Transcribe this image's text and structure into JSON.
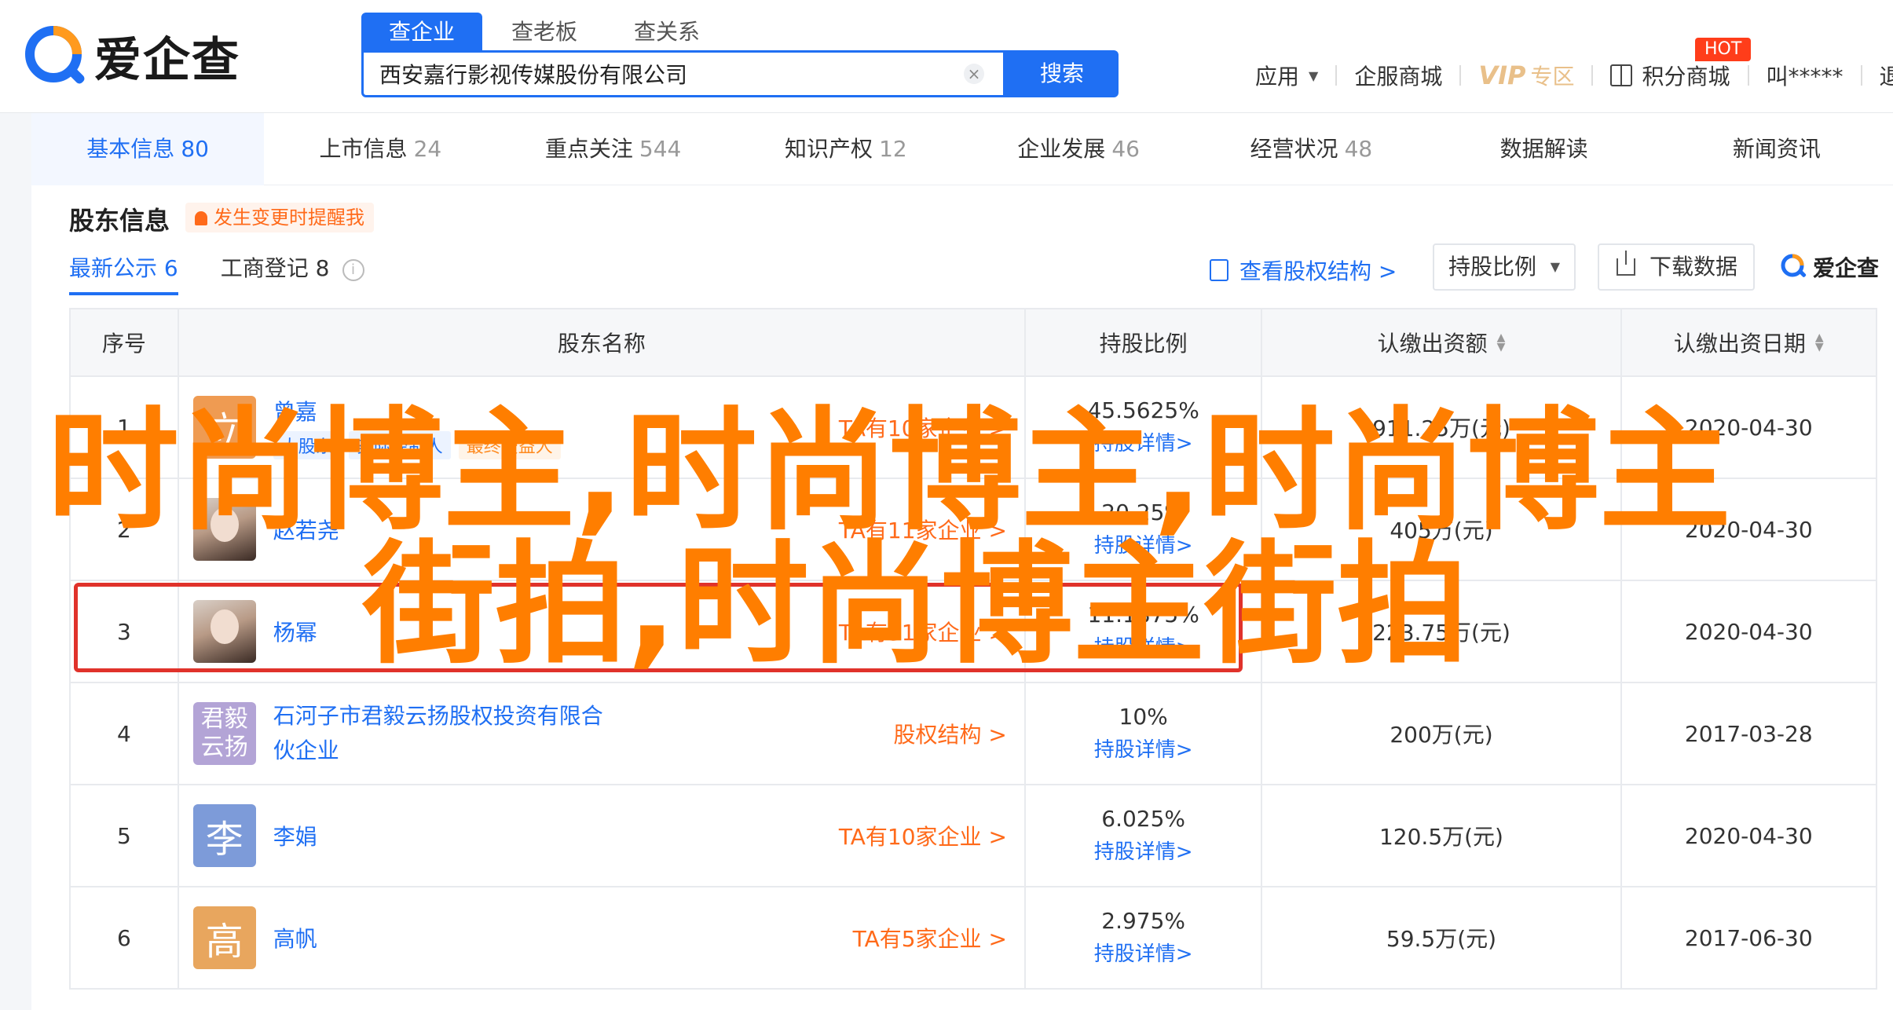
{
  "header": {
    "logo_text": "爱企查",
    "search_tabs": [
      "查企业",
      "查老板",
      "查关系"
    ],
    "search_value": "西安嘉行影视传媒股份有限公司",
    "search_button": "搜索",
    "nav": {
      "apps": "应用",
      "enterprise_mall": "企服商城",
      "vip": "VIP",
      "vip_zone": "专区",
      "points_mall": "积分商城",
      "hot_badge": "HOT",
      "user": "叫*****",
      "logout": "退出"
    }
  },
  "tabs": [
    {
      "label": "基本信息",
      "count": "80"
    },
    {
      "label": "上市信息",
      "count": "24"
    },
    {
      "label": "重点关注",
      "count": "544"
    },
    {
      "label": "知识产权",
      "count": "12"
    },
    {
      "label": "企业发展",
      "count": "46"
    },
    {
      "label": "经营状况",
      "count": "48"
    },
    {
      "label": "数据解读",
      "count": ""
    },
    {
      "label": "新闻资讯",
      "count": ""
    }
  ],
  "section": {
    "title": "股东信息",
    "alert": "发生变更时提醒我",
    "subtabs": [
      {
        "label": "最新公示",
        "count": "6"
      },
      {
        "label": "工商登记",
        "count": "8"
      }
    ],
    "equity_link": "查看股权结构 >",
    "dropdown": "持股比例",
    "download": "下载数据",
    "watermark_logo": "爱企查"
  },
  "table": {
    "headers": [
      "序号",
      "股东名称",
      "持股比例",
      "认缴出资额",
      "认缴出资日期"
    ],
    "rows": [
      {
        "idx": "1",
        "avatar": "立",
        "name": "曾嘉",
        "tags": [
          "大股东",
          "实际控制人",
          "最终受益人"
        ],
        "assoc": "TA有10家企业 >",
        "ratio": "45.5625%",
        "detail": "持股详情>",
        "amount": "911.25万(元)",
        "date": "2020-04-30"
      },
      {
        "idx": "2",
        "avatar": "",
        "name": "赵若尧",
        "tags": [],
        "assoc": "TA有11家企业 >",
        "ratio": "20.25%",
        "detail": "持股详情>",
        "amount": "405万(元)",
        "date": "2020-04-30"
      },
      {
        "idx": "3",
        "avatar": "",
        "name": "杨幂",
        "tags": [],
        "assoc": "TA有31家企业 >",
        "ratio": "11.1875%",
        "detail": "持股详情>",
        "amount": "223.75万(元)",
        "date": "2020-04-30"
      },
      {
        "idx": "4",
        "avatar": "君毅云扬",
        "name": "石河子市君毅云扬股权投资有限合伙企业",
        "tags": [],
        "assoc": "股权结构 >",
        "ratio": "10%",
        "detail": "持股详情>",
        "amount": "200万(元)",
        "date": "2017-03-28"
      },
      {
        "idx": "5",
        "avatar": "李",
        "name": "李娟",
        "tags": [],
        "assoc": "TA有10家企业 >",
        "ratio": "6.025%",
        "detail": "持股详情>",
        "amount": "120.5万(元)",
        "date": "2020-04-30"
      },
      {
        "idx": "6",
        "avatar": "高",
        "name": "高帆",
        "tags": [],
        "assoc": "TA有5家企业 >",
        "ratio": "2.975%",
        "detail": "持股详情>",
        "amount": "59.5万(元)",
        "date": "2017-06-30"
      }
    ]
  },
  "overlay": {
    "line1": "时尚博主,时尚博主,时尚博主",
    "line2": "街拍,时尚博主街拍"
  },
  "colors": {
    "brand_blue": "#1f6ff3",
    "alert_orange": "#ff6a1a",
    "highlight_red": "#e0322b",
    "overlay_orange": "#ff7e00",
    "avatar_1": "#ef9b52",
    "avatar_4": "#b3a4d6",
    "avatar_5": "#7d9bd9",
    "avatar_6": "#e8a65e"
  }
}
